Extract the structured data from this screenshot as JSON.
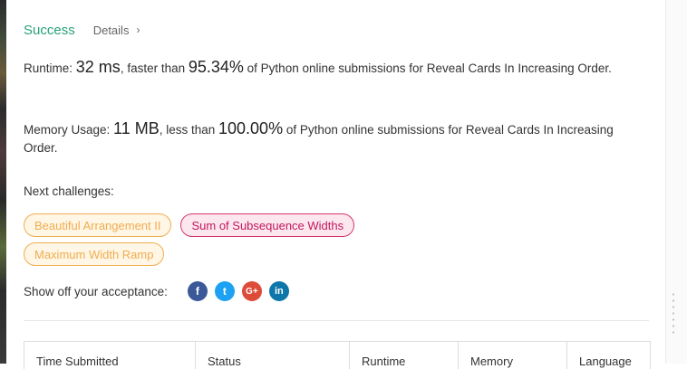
{
  "result": {
    "status": "Success",
    "details_label": "Details",
    "details_chevron": "›"
  },
  "runtime": {
    "label": "Runtime: ",
    "value": "32 ms",
    "middle": ", faster than ",
    "percent": "95.34%",
    "suffix": " of Python online submissions for Reveal Cards In Increasing Order."
  },
  "memory": {
    "label": "Memory Usage: ",
    "value": "11 MB",
    "middle": ", less than ",
    "percent": "100.00%",
    "suffix": " of Python online submissions for Reveal Cards In Increasing Order."
  },
  "next": {
    "label": "Next challenges:",
    "items": [
      {
        "label": "Beautiful Arrangement II",
        "difficulty": "medium"
      },
      {
        "label": "Sum of Subsequence Widths",
        "difficulty": "hard"
      },
      {
        "label": "Maximum Width Ramp",
        "difficulty": "medium"
      }
    ]
  },
  "share": {
    "label": "Show off your acceptance:",
    "icons": {
      "facebook": "f",
      "twitter": "t",
      "google_plus": "G+",
      "linkedin": "in"
    }
  },
  "table": {
    "headers": [
      "Time Submitted",
      "Status",
      "Runtime",
      "Memory",
      "Language"
    ]
  },
  "colors": {
    "success": "#26a17b",
    "medium": "#f0ad4e",
    "hard": "#c2185b",
    "facebook": "#3b5998",
    "twitter": "#1da1f2",
    "google_plus": "#dd4b39",
    "linkedin": "#0e76a8"
  }
}
